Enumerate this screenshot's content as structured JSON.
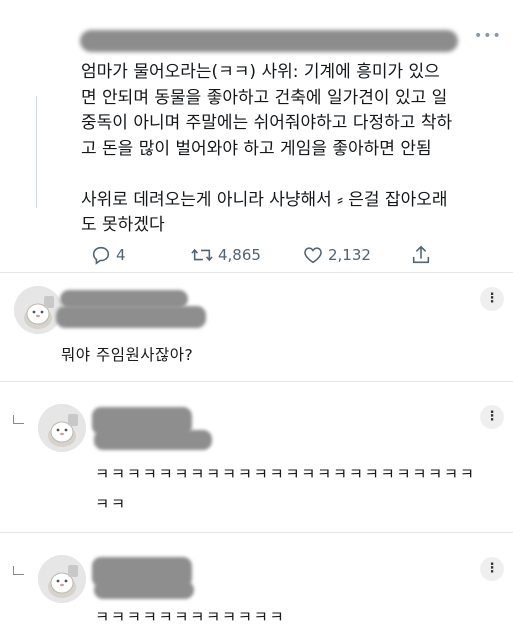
{
  "tweet": {
    "text": "엄마가 물어오라는(ㅋㅋ) 사위: 기계에 흥미가 있으\n면 안되며 동물을 좋아하고 건축에 일가견이 있고 일\n중독이 아니며 주말에는 쉬어줘야하고 다정하고 착하\n고 돈을 많이 벌어와야 하고 게임을 좋아하면 안됨\n\n사위로 데려오는게 아니라 사냥해서 ⸗ 은걸 잡아오래\n도 못하겠다",
    "more_label": "•••",
    "replies_count": "4",
    "retweets_count": "4,865",
    "likes_count": "2,132"
  },
  "comments": [
    {
      "text": "뭐야 주임원사잖아?",
      "is_reply": false
    },
    {
      "text": "ㅋㅋㅋㅋㅋㅋㅋㅋㅋㅋㅋㅋㅋㅋㅋㅋㅋㅋㅋㅋㅋㅋㅋㅋ\nㅋㅋ",
      "is_reply": true
    },
    {
      "text": "ㅋㅋㅋㅋㅋㅋㅋㅋㅋㅋㅋㅋ",
      "is_reply": true
    }
  ],
  "kebab_label": "⋮",
  "colors": {
    "action_gray": "#536471",
    "thread_line": "#cfd9de",
    "blur_gray": "#8e8e8e"
  }
}
